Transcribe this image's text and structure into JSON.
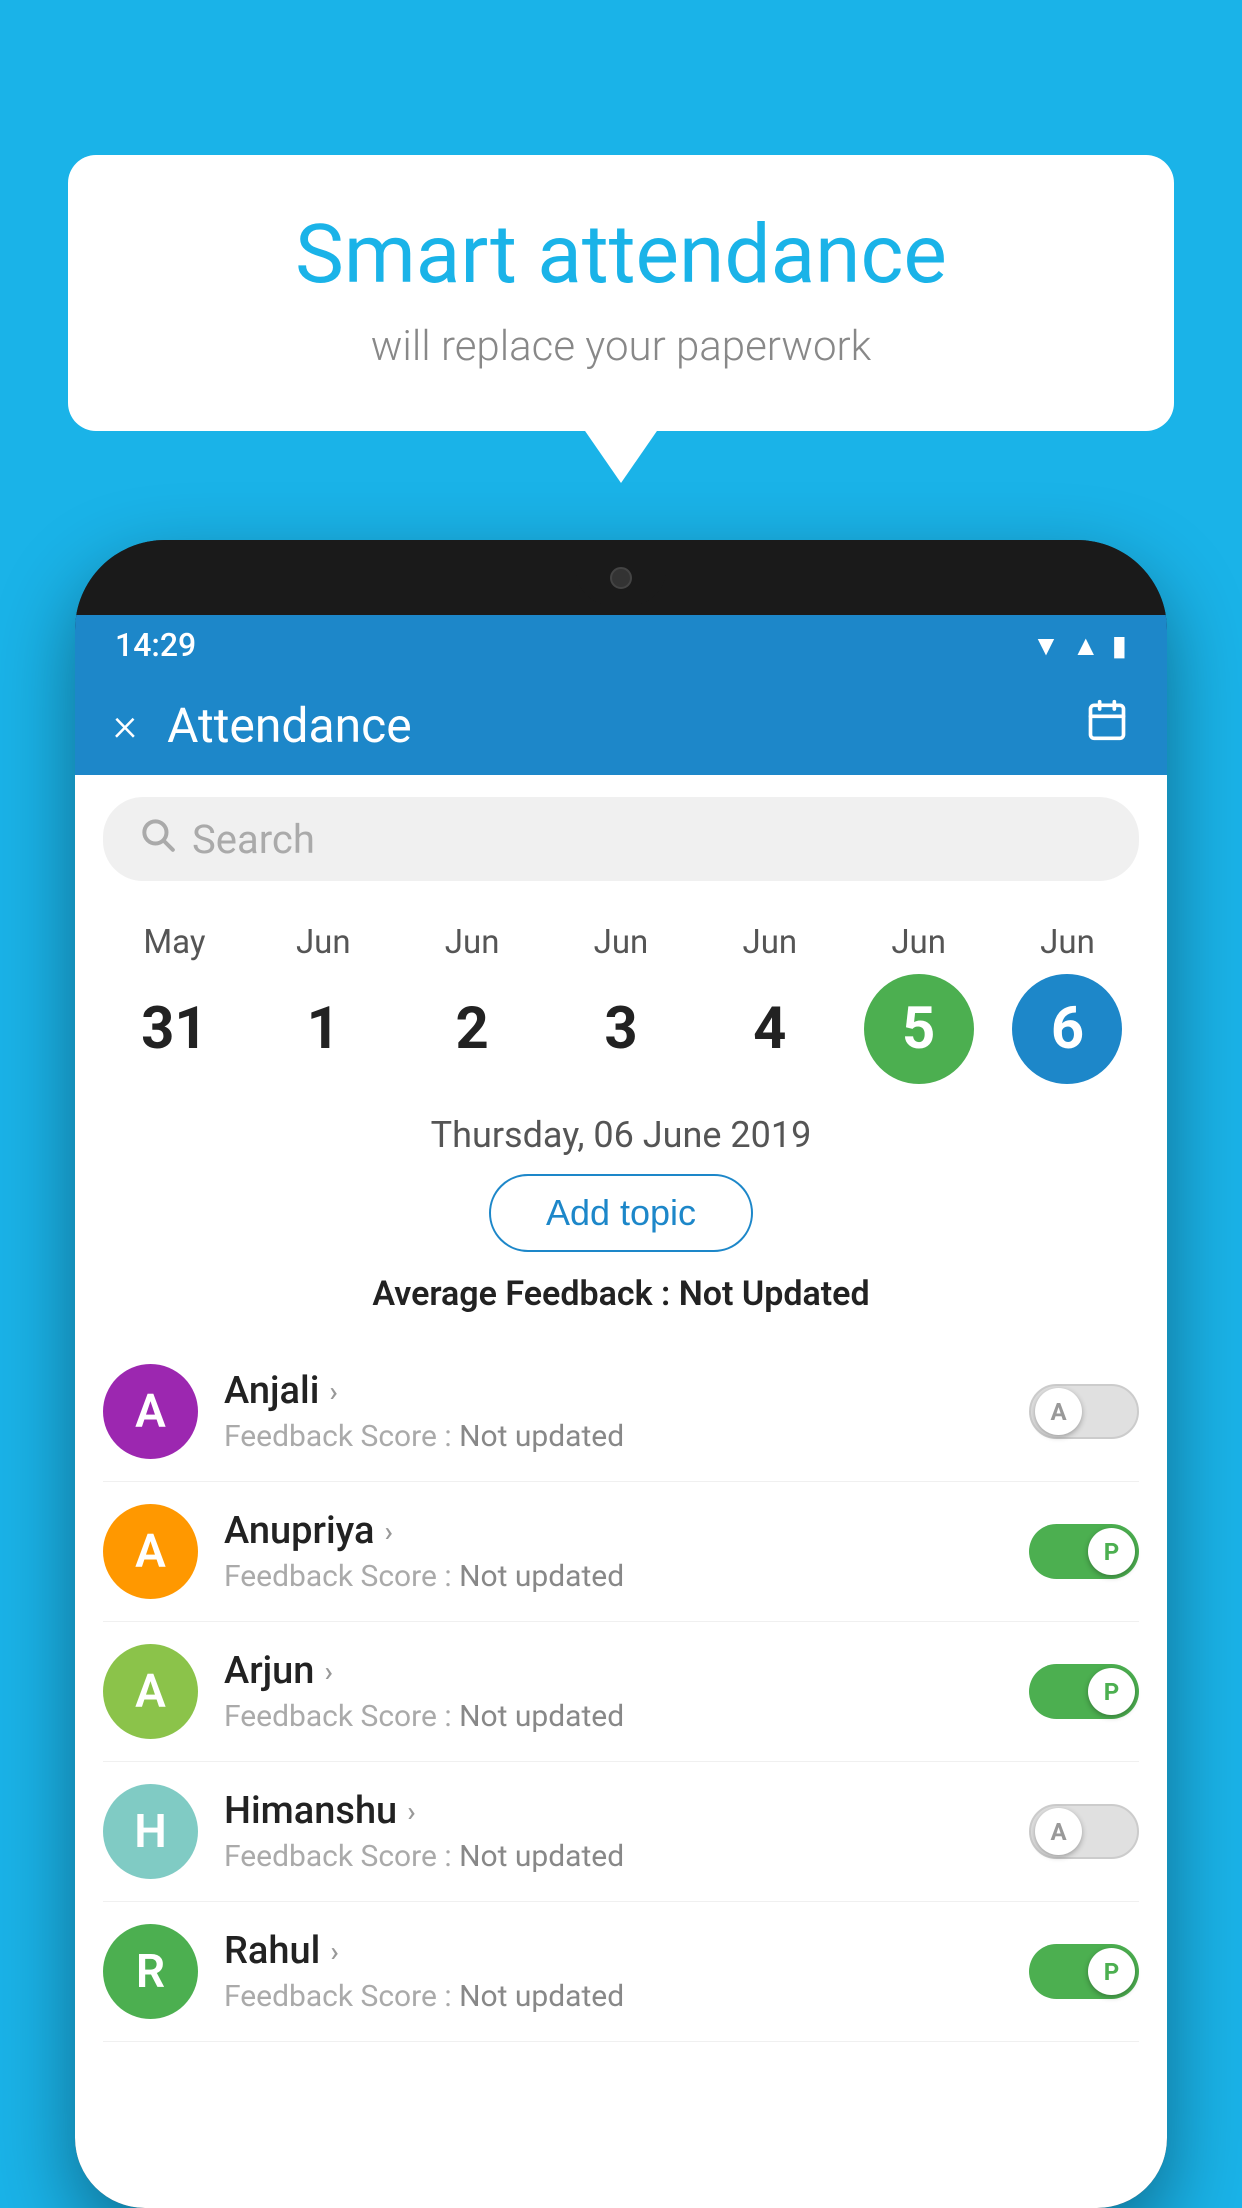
{
  "background_color": "#1ab3e8",
  "speech_bubble": {
    "title": "Smart attendance",
    "subtitle": "will replace your paperwork"
  },
  "status_bar": {
    "time": "14:29",
    "icons": [
      "wifi",
      "signal",
      "battery"
    ]
  },
  "app_header": {
    "title": "Attendance",
    "close_label": "×",
    "calendar_label": "📅"
  },
  "search": {
    "placeholder": "Search"
  },
  "date_strip": [
    {
      "month": "May",
      "day": "31",
      "active": false
    },
    {
      "month": "Jun",
      "day": "1",
      "active": false
    },
    {
      "month": "Jun",
      "day": "2",
      "active": false
    },
    {
      "month": "Jun",
      "day": "3",
      "active": false
    },
    {
      "month": "Jun",
      "day": "4",
      "active": false
    },
    {
      "month": "Jun",
      "day": "5",
      "active": "green"
    },
    {
      "month": "Jun",
      "day": "6",
      "active": "blue"
    }
  ],
  "selected_date": "Thursday, 06 June 2019",
  "add_topic_label": "Add topic",
  "avg_feedback_label": "Average Feedback : ",
  "avg_feedback_value": "Not Updated",
  "students": [
    {
      "name": "Anjali",
      "avatar_letter": "A",
      "avatar_color": "purple",
      "feedback_label": "Feedback Score : ",
      "feedback_value": "Not updated",
      "toggle": "off",
      "toggle_letter": "A"
    },
    {
      "name": "Anupriya",
      "avatar_letter": "A",
      "avatar_color": "orange",
      "feedback_label": "Feedback Score : ",
      "feedback_value": "Not updated",
      "toggle": "on",
      "toggle_letter": "P"
    },
    {
      "name": "Arjun",
      "avatar_letter": "A",
      "avatar_color": "light-green",
      "feedback_label": "Feedback Score : ",
      "feedback_value": "Not updated",
      "toggle": "on",
      "toggle_letter": "P"
    },
    {
      "name": "Himanshu",
      "avatar_letter": "H",
      "avatar_color": "teal",
      "feedback_label": "Feedback Score : ",
      "feedback_value": "Not updated",
      "toggle": "off",
      "toggle_letter": "A"
    },
    {
      "name": "Rahul",
      "avatar_letter": "R",
      "avatar_color": "green",
      "feedback_label": "Feedback Score : ",
      "feedback_value": "Not updated",
      "toggle": "on",
      "toggle_letter": "P"
    }
  ]
}
